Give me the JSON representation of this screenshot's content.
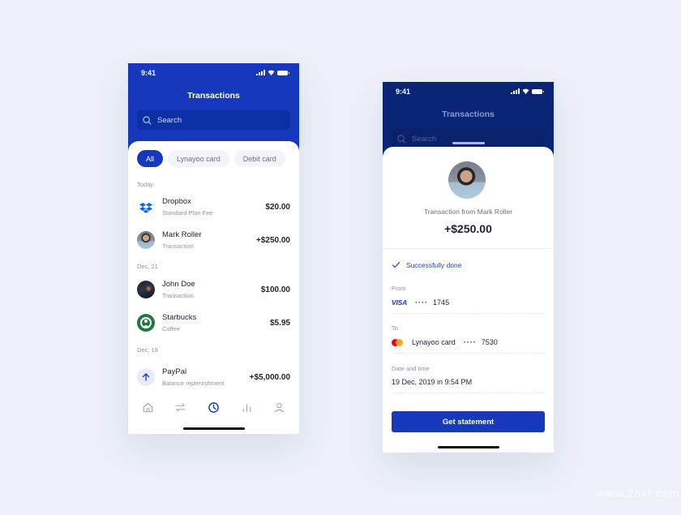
{
  "list_screen": {
    "status_time": "9:41",
    "title": "Transactions",
    "search_placeholder": "Search",
    "filters": [
      {
        "label": "All",
        "active": true
      },
      {
        "label": "Lynayoo card",
        "active": false
      },
      {
        "label": "Debit card",
        "active": false
      }
    ],
    "groups": [
      {
        "label": "Today",
        "items": [
          {
            "name": "Dropbox",
            "sub": "Standard Plan Fee",
            "amount": "$20.00",
            "icon": "dropbox-logo"
          },
          {
            "name": "Mark Roller",
            "sub": "Transaction",
            "amount": "+$250.00",
            "icon": "avatar-photo"
          }
        ]
      },
      {
        "label": "Dec, 21",
        "items": [
          {
            "name": "John Doe",
            "sub": "Transaction",
            "amount": "$100.00",
            "icon": "avatar-photo"
          },
          {
            "name": "Starbucks",
            "sub": "Coffee",
            "amount": "$5.95",
            "icon": "starbucks-logo"
          }
        ]
      },
      {
        "label": "Dec, 19",
        "items": [
          {
            "name": "PayPal",
            "sub": "Balance replenishment",
            "amount": "+$5,000.00",
            "icon": "arrow-up-icon"
          }
        ]
      }
    ],
    "tabbar": [
      {
        "icon": "home-icon",
        "active": false
      },
      {
        "icon": "transfer-icon",
        "active": false
      },
      {
        "icon": "clock-icon",
        "active": true
      },
      {
        "icon": "chart-icon",
        "active": false
      },
      {
        "icon": "profile-icon",
        "active": false
      }
    ]
  },
  "detail_screen": {
    "status_time": "9:41",
    "title": "Transactions",
    "search_placeholder": "Search",
    "subtitle": "Transaction from Mark Roller",
    "amount": "+$250.00",
    "status": "Successfully done",
    "from_label": "From",
    "from_card_brand": "VISA",
    "from_card_mask": "····",
    "from_card_last4": "1745",
    "to_label": "To",
    "to_card_name": "Lynayoo card",
    "to_card_mask": "····",
    "to_card_last4": "7530",
    "date_label": "Date and time",
    "date_value": "19 Dec, 2019 in 9:54 PM",
    "button": "Get statement"
  },
  "colors": {
    "primary": "#1638bc",
    "primary_dark": "#0b2576",
    "background": "#edf0f8",
    "text": "#1d2233",
    "muted": "#8e94a6"
  }
}
